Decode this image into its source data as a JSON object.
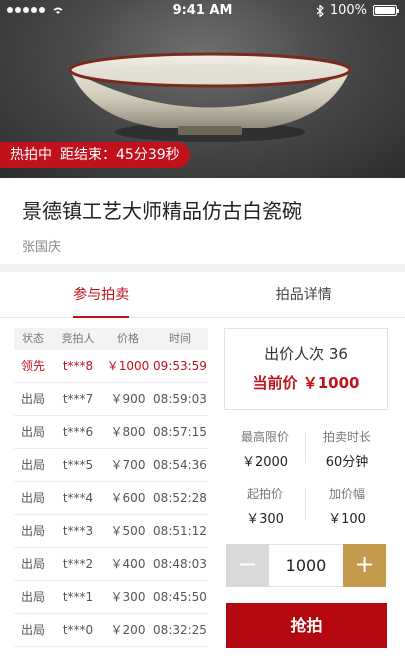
{
  "status_bar": {
    "time": "9:41 AM",
    "battery": "100%",
    "battery_level": 1.0,
    "signal_dots": 5
  },
  "hero": {
    "badge_status": "热拍中",
    "badge_countdown": "距结束：45分39秒",
    "colors": {
      "badge": "#c1121c"
    }
  },
  "item": {
    "title": "景德镇工艺大师精品仿古白瓷碗",
    "author": "张国庆"
  },
  "tabs": [
    {
      "label": "参与拍卖",
      "active": true
    },
    {
      "label": "拍品详情",
      "active": false
    }
  ],
  "bid_table": {
    "headers": [
      "状态",
      "竞拍人",
      "价格",
      "时间"
    ],
    "rows": [
      {
        "status": "领先",
        "bidder": "t***8",
        "price": "￥1000",
        "time": "09:53:59"
      },
      {
        "status": "出局",
        "bidder": "t***7",
        "price": "￥900",
        "time": "08:59:03"
      },
      {
        "status": "出局",
        "bidder": "t***6",
        "price": "￥800",
        "time": "08:57:15"
      },
      {
        "status": "出局",
        "bidder": "t***5",
        "price": "￥700",
        "time": "08:54:36"
      },
      {
        "status": "出局",
        "bidder": "t***4",
        "price": "￥600",
        "time": "08:52:28"
      },
      {
        "status": "出局",
        "bidder": "t***3",
        "price": "￥500",
        "time": "08:51:12"
      },
      {
        "status": "出局",
        "bidder": "t***2",
        "price": "￥400",
        "time": "08:48:03"
      },
      {
        "status": "出局",
        "bidder": "t***1",
        "price": "￥300",
        "time": "08:45:50"
      },
      {
        "status": "出局",
        "bidder": "t***0",
        "price": "￥200",
        "time": "08:32:25"
      }
    ]
  },
  "summary": {
    "bid_count": "出价人次 36",
    "current_price": "当前价 ￥1000"
  },
  "info": {
    "max_price_label": "最高限价",
    "max_price_value": "￥2000",
    "duration_label": "拍卖时长",
    "duration_value": "60分钟",
    "start_price_label": "起拍价",
    "start_price_value": "￥300",
    "increment_label": "加价幅",
    "increment_value": "￥100"
  },
  "stepper": {
    "minus": "−",
    "value": "1000",
    "plus": "+"
  },
  "bid_button": {
    "label": "抢拍"
  },
  "colors": {
    "accent": "#c1121c",
    "gold": "#c49a4d",
    "button": "#b5070f"
  }
}
